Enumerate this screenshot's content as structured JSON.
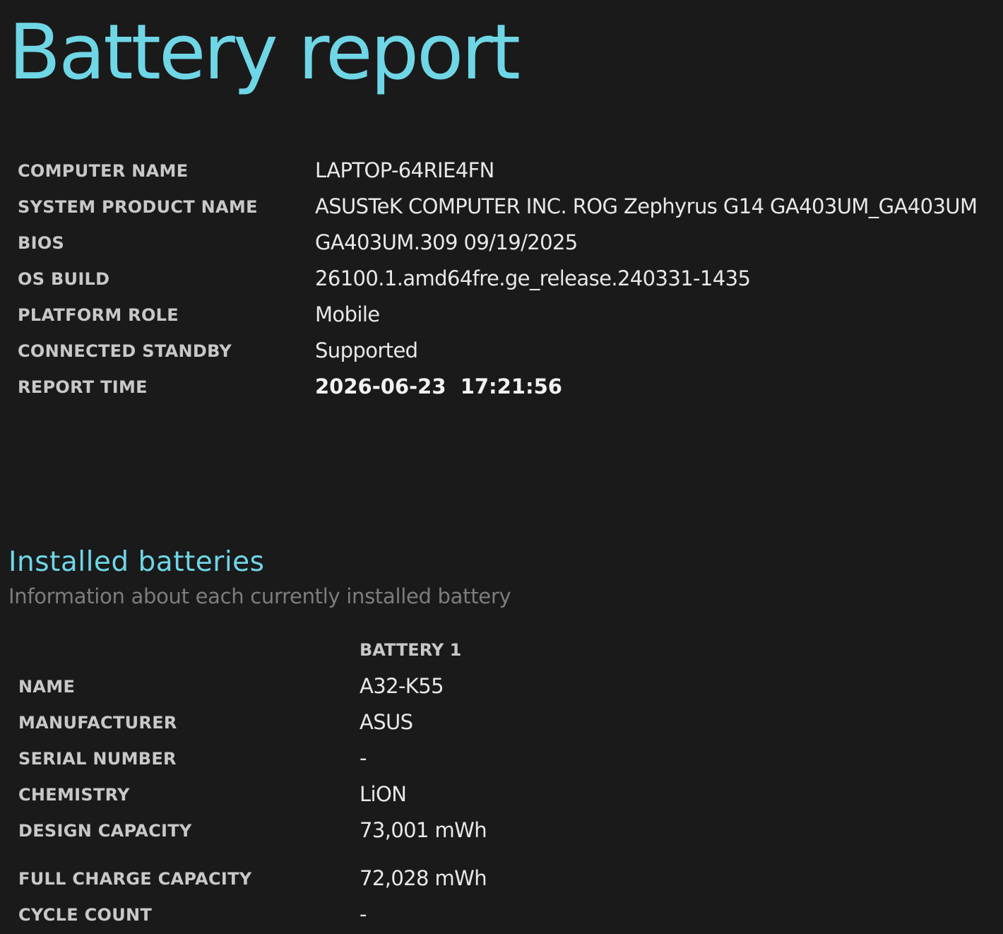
{
  "title": "Battery report",
  "system_info": [
    {
      "label": "COMPUTER NAME",
      "value": "LAPTOP-64RIE4FN"
    },
    {
      "label": "SYSTEM PRODUCT NAME",
      "value": "ASUSTeK COMPUTER INC. ROG Zephyrus G14 GA403UM_GA403UM"
    },
    {
      "label": "BIOS",
      "value": "GA403UM.309 09/19/2025"
    },
    {
      "label": "OS BUILD",
      "value": "26100.1.amd64fre.ge_release.240331-1435"
    },
    {
      "label": "PLATFORM ROLE",
      "value": "Mobile"
    },
    {
      "label": "CONNECTED STANDBY",
      "value": "Supported"
    },
    {
      "label": "REPORT TIME",
      "value": "2026-06-23  17:21:56"
    }
  ],
  "installed_batteries": {
    "title": "Installed batteries",
    "subtitle": "Information about each currently installed battery",
    "column_header": "BATTERY 1",
    "rows": [
      {
        "label": "NAME",
        "value": "A32-K55"
      },
      {
        "label": "MANUFACTURER",
        "value": "ASUS"
      },
      {
        "label": "SERIAL NUMBER",
        "value": "-"
      },
      {
        "label": "CHEMISTRY",
        "value": "LiON"
      },
      {
        "label": "DESIGN CAPACITY",
        "value": "73,001 mWh"
      },
      {
        "label": "FULL CHARGE CAPACITY",
        "value": "72,028 mWh"
      },
      {
        "label": "CYCLE COUNT",
        "value": "-"
      }
    ]
  },
  "colors": {
    "background": "#1a1a1a",
    "accent": "#6fd6e6",
    "label": "#c8c8c8",
    "value": "#e8e8e8",
    "subtitle": "#7d7d7d"
  }
}
